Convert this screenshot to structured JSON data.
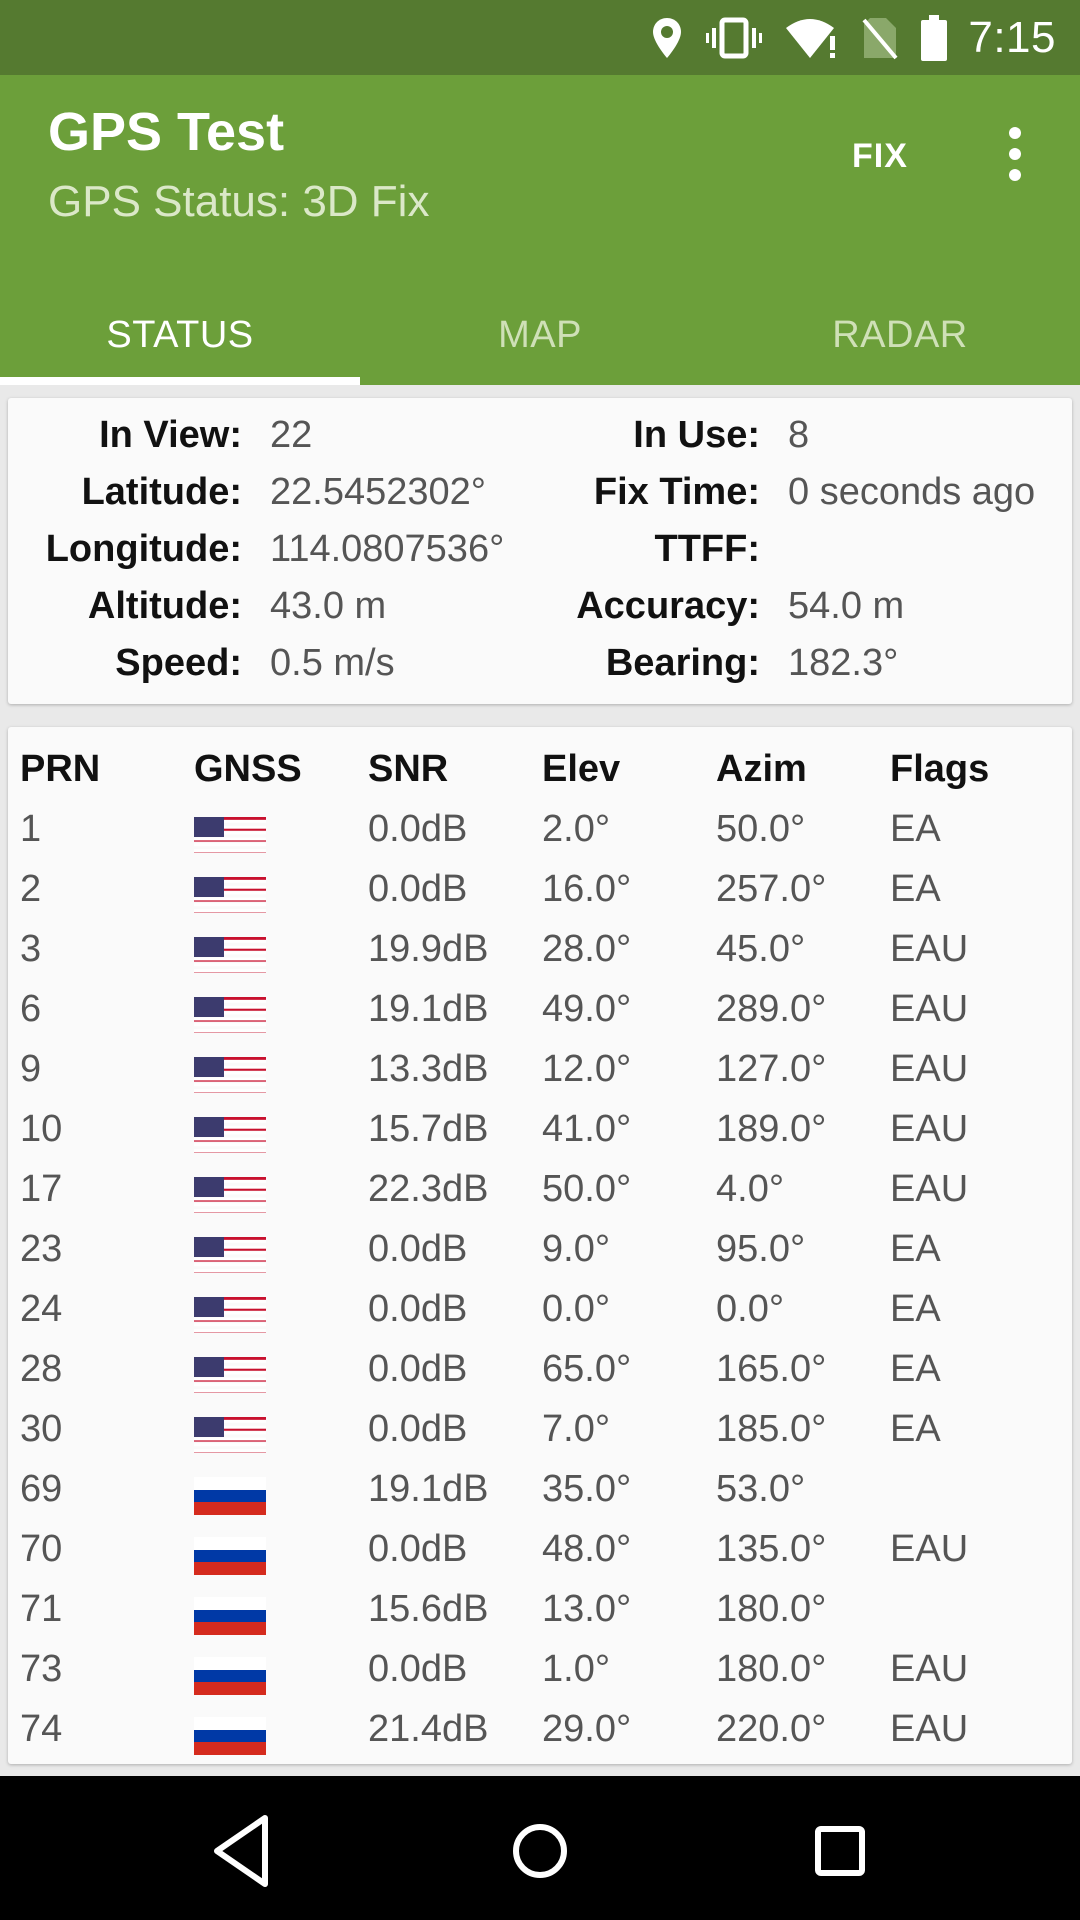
{
  "status_bar": {
    "time": "7:15",
    "icons": [
      "location-icon",
      "vibrate-icon",
      "wifi-icon",
      "no-sim-icon",
      "battery-icon"
    ]
  },
  "app_bar": {
    "title": "GPS Test",
    "subtitle": "GPS Status: 3D Fix",
    "fix_label": "FIX",
    "overflow_icon": "more-vert-icon"
  },
  "tabs": [
    {
      "label": "STATUS",
      "active": true
    },
    {
      "label": "MAP",
      "active": false
    },
    {
      "label": "RADAR",
      "active": false
    }
  ],
  "info": {
    "in_view_label": "In View:",
    "in_view": "22",
    "in_use_label": "In Use:",
    "in_use": "8",
    "latitude_label": "Latitude:",
    "latitude": "22.5452302°",
    "fix_time_label": "Fix Time:",
    "fix_time": "0 seconds ago",
    "longitude_label": "Longitude:",
    "longitude": "114.0807536°",
    "ttff_label": "TTFF:",
    "ttff": "",
    "altitude_label": "Altitude:",
    "altitude": "43.0 m",
    "accuracy_label": "Accuracy:",
    "accuracy": "54.0 m",
    "speed_label": "Speed:",
    "speed": "0.5 m/s",
    "bearing_label": "Bearing:",
    "bearing": "182.3°"
  },
  "satellites": {
    "headers": {
      "prn": "PRN",
      "gnss": "GNSS",
      "snr": "SNR",
      "elev": "Elev",
      "azim": "Azim",
      "flags": "Flags"
    },
    "rows": [
      {
        "prn": "1",
        "gnss": "us-flag-icon",
        "snr": "0.0dB",
        "elev": "2.0°",
        "azim": "50.0°",
        "flags": "EA"
      },
      {
        "prn": "2",
        "gnss": "us-flag-icon",
        "snr": "0.0dB",
        "elev": "16.0°",
        "azim": "257.0°",
        "flags": "EA"
      },
      {
        "prn": "3",
        "gnss": "us-flag-icon",
        "snr": "19.9dB",
        "elev": "28.0°",
        "azim": "45.0°",
        "flags": "EAU"
      },
      {
        "prn": "6",
        "gnss": "us-flag-icon",
        "snr": "19.1dB",
        "elev": "49.0°",
        "azim": "289.0°",
        "flags": "EAU"
      },
      {
        "prn": "9",
        "gnss": "us-flag-icon",
        "snr": "13.3dB",
        "elev": "12.0°",
        "azim": "127.0°",
        "flags": "EAU"
      },
      {
        "prn": "10",
        "gnss": "us-flag-icon",
        "snr": "15.7dB",
        "elev": "41.0°",
        "azim": "189.0°",
        "flags": "EAU"
      },
      {
        "prn": "17",
        "gnss": "us-flag-icon",
        "snr": "22.3dB",
        "elev": "50.0°",
        "azim": "4.0°",
        "flags": "EAU"
      },
      {
        "prn": "23",
        "gnss": "us-flag-icon",
        "snr": "0.0dB",
        "elev": "9.0°",
        "azim": "95.0°",
        "flags": "EA"
      },
      {
        "prn": "24",
        "gnss": "us-flag-icon",
        "snr": "0.0dB",
        "elev": "0.0°",
        "azim": "0.0°",
        "flags": "EA"
      },
      {
        "prn": "28",
        "gnss": "us-flag-icon",
        "snr": "0.0dB",
        "elev": "65.0°",
        "azim": "165.0°",
        "flags": "EA"
      },
      {
        "prn": "30",
        "gnss": "us-flag-icon",
        "snr": "0.0dB",
        "elev": "7.0°",
        "azim": "185.0°",
        "flags": "EA"
      },
      {
        "prn": "69",
        "gnss": "russia-flag-icon",
        "snr": "19.1dB",
        "elev": "35.0°",
        "azim": "53.0°",
        "flags": ""
      },
      {
        "prn": "70",
        "gnss": "russia-flag-icon",
        "snr": "0.0dB",
        "elev": "48.0°",
        "azim": "135.0°",
        "flags": "EAU"
      },
      {
        "prn": "71",
        "gnss": "russia-flag-icon",
        "snr": "15.6dB",
        "elev": "13.0°",
        "azim": "180.0°",
        "flags": ""
      },
      {
        "prn": "73",
        "gnss": "russia-flag-icon",
        "snr": "0.0dB",
        "elev": "1.0°",
        "azim": "180.0°",
        "flags": "EAU"
      },
      {
        "prn": "74",
        "gnss": "russia-flag-icon",
        "snr": "21.4dB",
        "elev": "29.0°",
        "azim": "220.0°",
        "flags": "EAU"
      }
    ]
  },
  "nav_bar": {
    "icons": [
      "back-icon",
      "home-icon",
      "recents-icon"
    ]
  },
  "colors": {
    "status_bar": "#557a30",
    "app_bar": "#6c9f3a",
    "card": "#fafafa",
    "background": "#e9e9e9"
  }
}
